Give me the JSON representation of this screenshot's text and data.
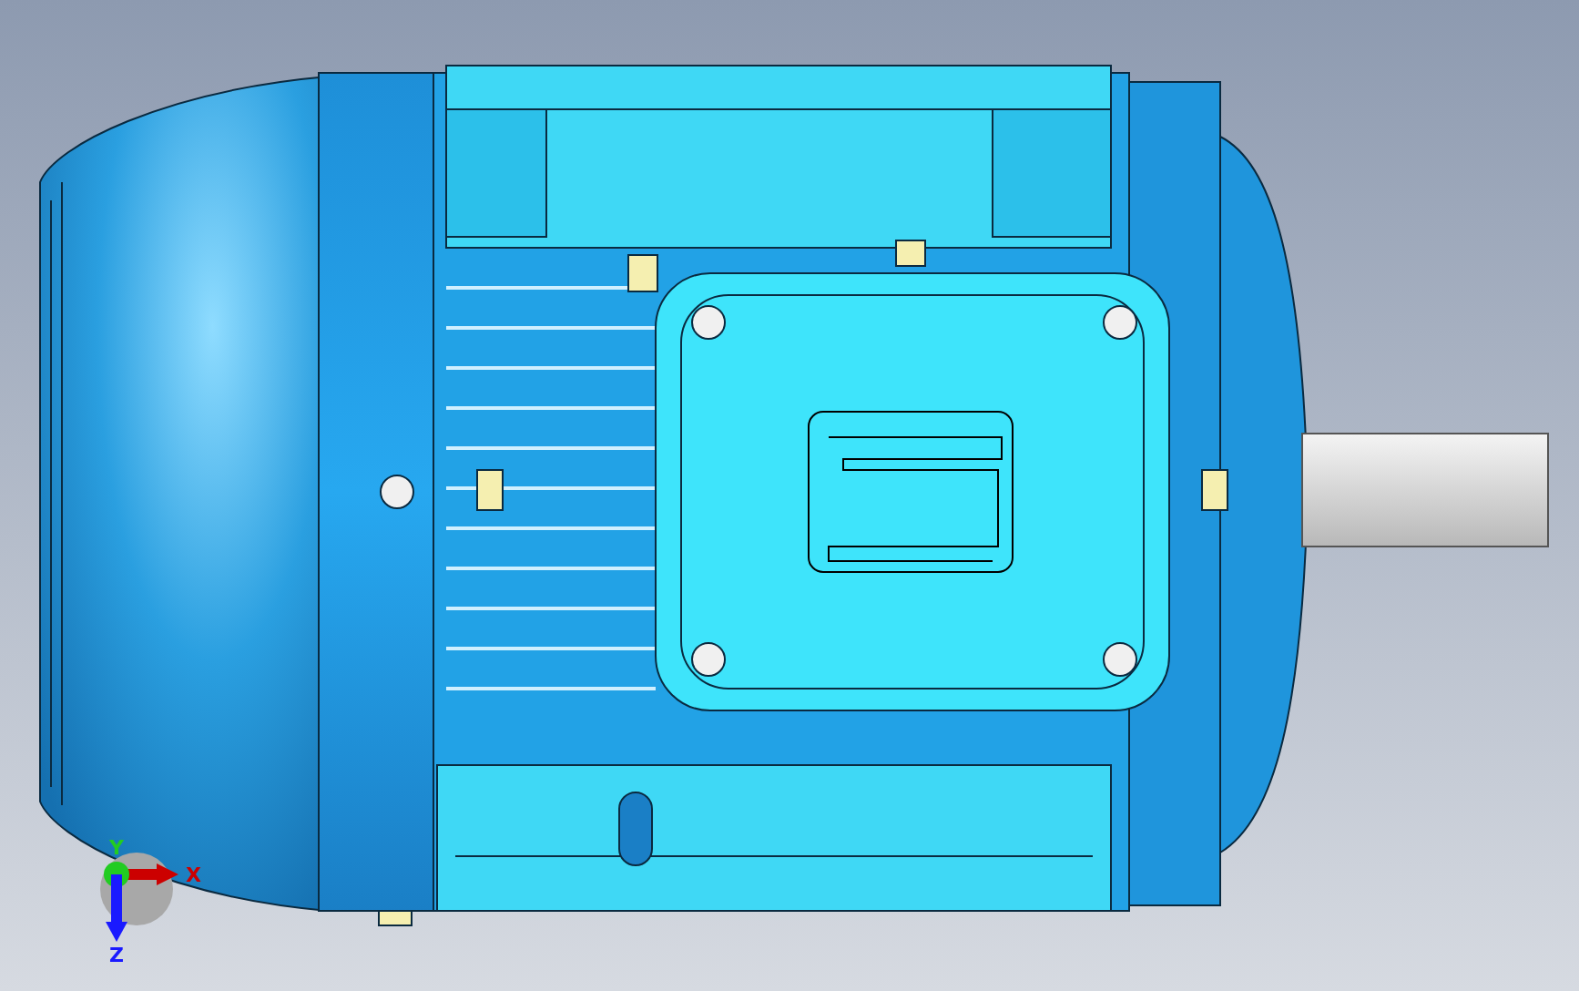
{
  "viewport": {
    "triad": {
      "axes": [
        {
          "label": "X",
          "kind": "right",
          "color": "#cc0000"
        },
        {
          "label": "Y",
          "kind": "up",
          "color": "#22cc22"
        },
        {
          "label": "Z",
          "kind": "down",
          "color": "#1a1aff"
        }
      ]
    }
  }
}
